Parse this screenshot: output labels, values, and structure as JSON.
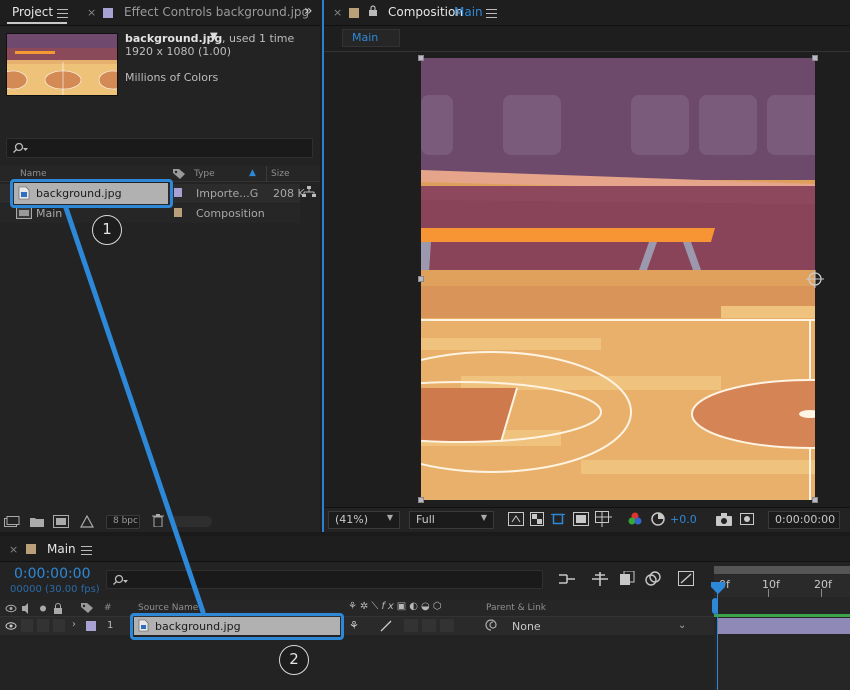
{
  "project": {
    "tab_project": "Project",
    "tab_effect_controls": "Effect Controls background.jpg",
    "overflow": "»",
    "file_name": "background.jpg",
    "file_usage": ", used 1 time",
    "file_dimensions": "1920 x 1080 (1.00)",
    "file_colors": "Millions of Colors",
    "columns": {
      "name": "Name",
      "type": "Type",
      "size": "Size"
    },
    "items": [
      {
        "name": "background.jpg",
        "type": "Importe...G",
        "size": "208 K"
      },
      {
        "name": "Main",
        "type": "Composition",
        "size": ""
      }
    ],
    "bpc": "8 bpc"
  },
  "composition": {
    "tab_prefix": "Composition",
    "tab_name": "Main",
    "sub_tab": "Main",
    "zoom": "(41%)",
    "resolution": "Full",
    "exposure": "+0.0",
    "timecode": "0:00:00:00"
  },
  "timeline": {
    "tab": "Main",
    "timecode": "0:00:00:00",
    "frames": "00000 (30.00 fps)",
    "columns": {
      "num": "#",
      "source_name": "Source Name",
      "parent": "Parent & Link"
    },
    "layer": {
      "num": "1",
      "name": "background.jpg",
      "parent": "None"
    },
    "ruler": [
      "0f",
      "10f",
      "20f"
    ]
  },
  "callouts": {
    "one": "1",
    "two": "2"
  },
  "colors": {
    "accent": "#2e88d8",
    "timecode": "#2e88d8"
  }
}
